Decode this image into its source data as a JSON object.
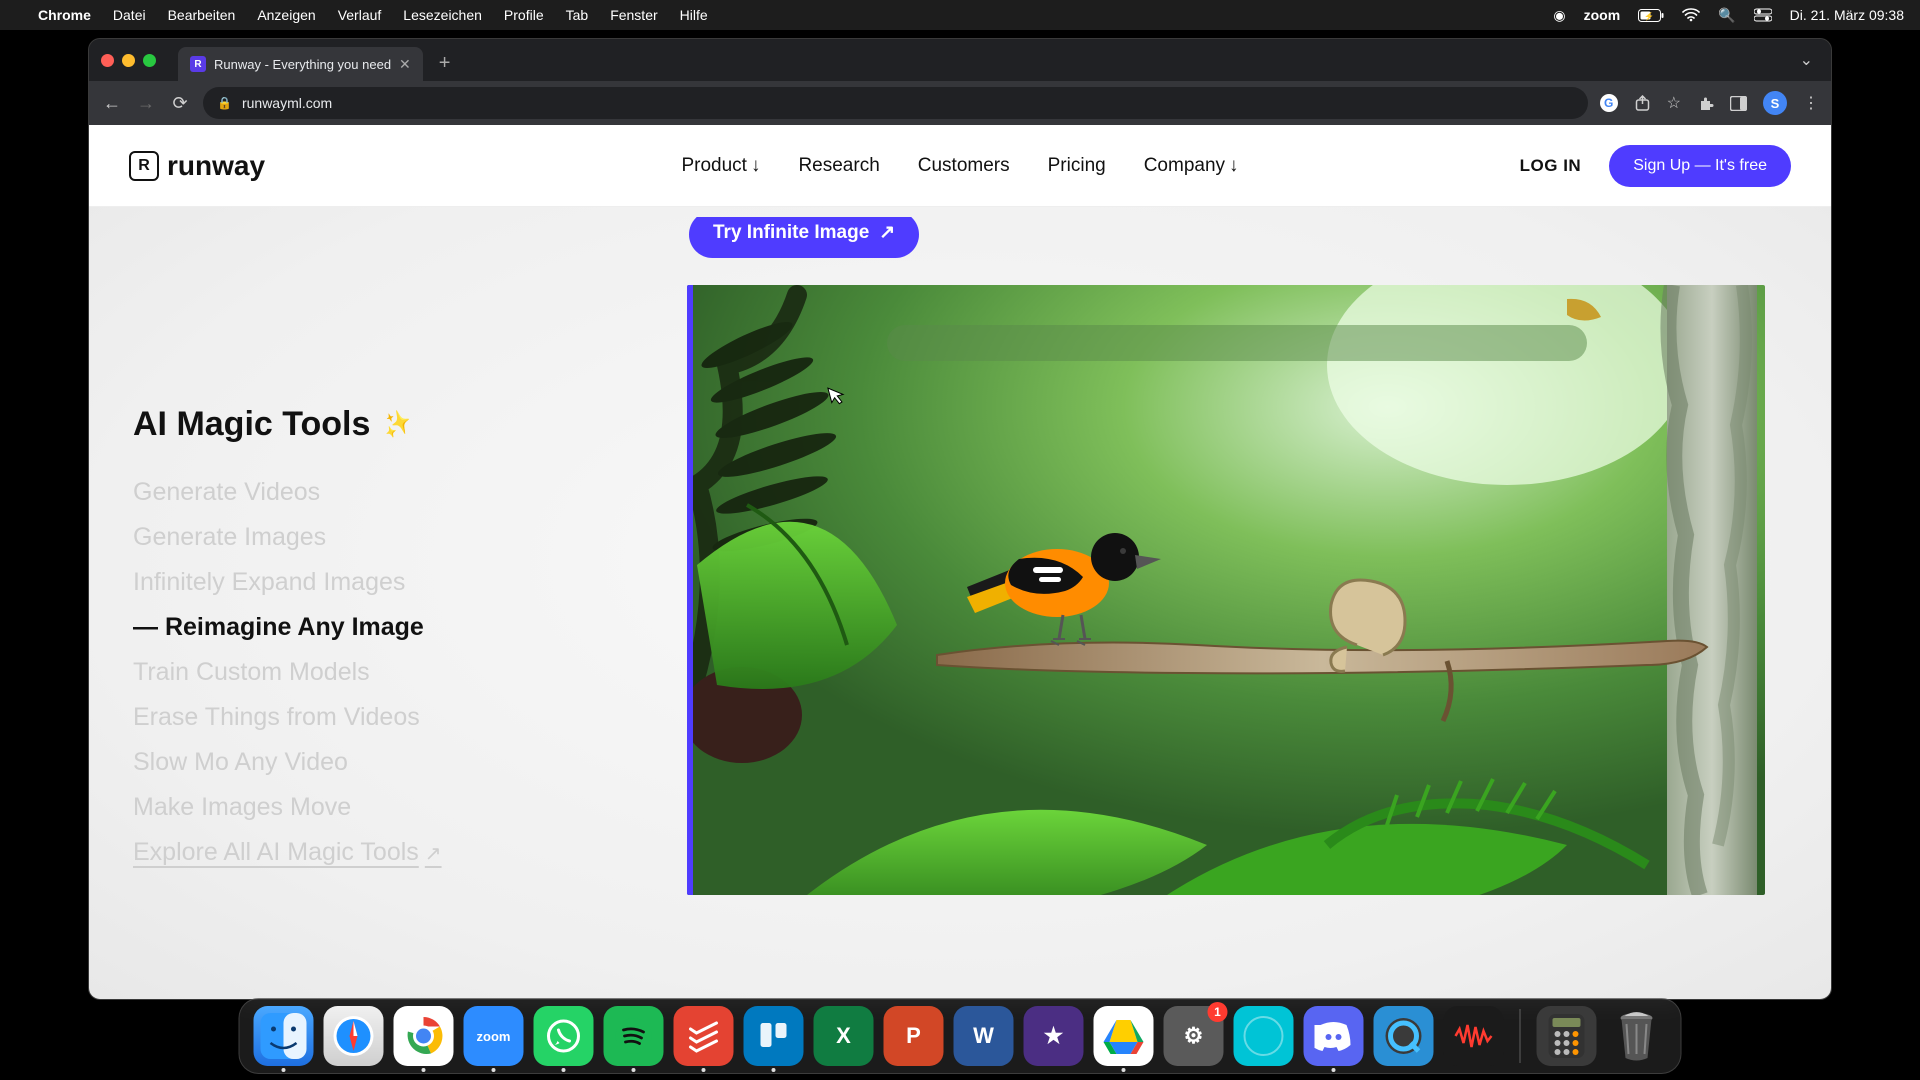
{
  "menubar": {
    "app": "Chrome",
    "items": [
      "Datei",
      "Bearbeiten",
      "Anzeigen",
      "Verlauf",
      "Lesezeichen",
      "Profile",
      "Tab",
      "Fenster",
      "Hilfe"
    ],
    "zoom_label": "zoom",
    "datetime": "Di. 21. März  09:38"
  },
  "browser": {
    "tab_title": "Runway - Everything you need",
    "url": "runwayml.com"
  },
  "nav": {
    "logo_text": "runway",
    "items": [
      {
        "label": "Product",
        "has_dropdown": true
      },
      {
        "label": "Research",
        "has_dropdown": false
      },
      {
        "label": "Customers",
        "has_dropdown": false
      },
      {
        "label": "Pricing",
        "has_dropdown": false
      },
      {
        "label": "Company",
        "has_dropdown": true
      }
    ],
    "login": "LOG IN",
    "signup": "Sign Up — It's free"
  },
  "cta": {
    "label": "Try Infinite Image"
  },
  "section": {
    "title": "AI Magic Tools",
    "tools": [
      {
        "label": "Generate Videos",
        "active": false
      },
      {
        "label": "Generate Images",
        "active": false
      },
      {
        "label": "Infinitely Expand Images",
        "active": false
      },
      {
        "label": "Reimagine Any Image",
        "active": true
      },
      {
        "label": "Train Custom Models",
        "active": false
      },
      {
        "label": "Erase Things from Videos",
        "active": false
      },
      {
        "label": "Slow Mo Any Video",
        "active": false
      },
      {
        "label": "Make Images Move",
        "active": false
      }
    ],
    "explore": "Explore All AI Magic Tools"
  },
  "dock": {
    "apps": [
      {
        "name": "finder",
        "glyph": "😊",
        "running": true
      },
      {
        "name": "safari",
        "glyph": "🧭",
        "running": false
      },
      {
        "name": "chrome",
        "glyph": "",
        "running": true
      },
      {
        "name": "zoomapp",
        "glyph": "zoom",
        "running": true
      },
      {
        "name": "whatsapp",
        "glyph": "",
        "running": true
      },
      {
        "name": "spotify",
        "glyph": "",
        "running": true
      },
      {
        "name": "todoist",
        "glyph": "✓",
        "running": true
      },
      {
        "name": "trello",
        "glyph": "",
        "running": true
      },
      {
        "name": "excel",
        "glyph": "X",
        "running": false
      },
      {
        "name": "ppt",
        "glyph": "P",
        "running": false
      },
      {
        "name": "word",
        "glyph": "W",
        "running": false
      },
      {
        "name": "imovie",
        "glyph": "★",
        "running": false
      },
      {
        "name": "gdrive",
        "glyph": "",
        "running": true
      },
      {
        "name": "settings",
        "glyph": "⚙",
        "running": false,
        "badge": "1"
      },
      {
        "name": "cyan",
        "glyph": "",
        "running": false
      },
      {
        "name": "discord",
        "glyph": "",
        "running": true
      },
      {
        "name": "qt",
        "glyph": "Q",
        "running": false
      },
      {
        "name": "voice",
        "glyph": "",
        "running": false
      }
    ],
    "right_apps": [
      {
        "name": "calc",
        "glyph": ""
      },
      {
        "name": "trash",
        "glyph": "🗑"
      }
    ]
  },
  "colors": {
    "primary": "#4f3cff"
  }
}
